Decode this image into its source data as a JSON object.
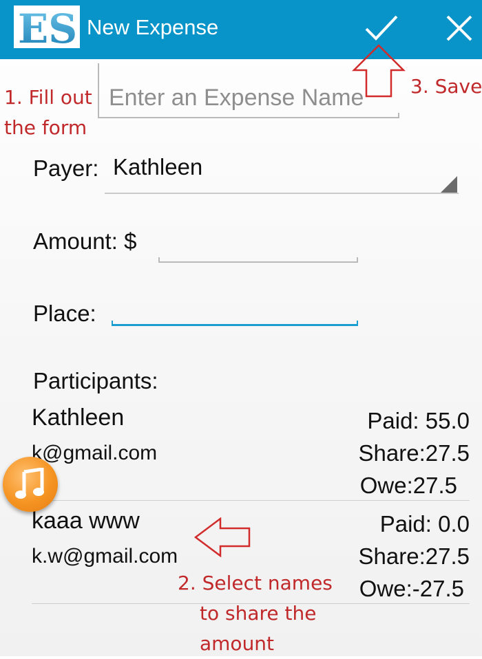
{
  "appbar": {
    "logo_text": "ES",
    "title": "New Expense",
    "save_icon": "check-icon",
    "close_icon": "close-icon",
    "color": "#0894c8"
  },
  "form": {
    "name_placeholder": "Enter an Expense Name",
    "name_value": "",
    "payer_label": "Payer:",
    "payer_value": "Kathleen",
    "amount_label": "Amount: $",
    "amount_value": "",
    "place_label": "Place:",
    "place_value": "",
    "participants_label": "Participants:"
  },
  "participants": [
    {
      "name": "Kathleen",
      "email": "k@gmail.com",
      "paid": "Paid: 55.0",
      "share": "Share:27.5",
      "owe": "Owe:27.5"
    },
    {
      "name": "kaaa www",
      "email": "k.w@gmail.com",
      "paid": "Paid: 0.0",
      "share": "Share:27.5",
      "owe": "Owe:-27.5"
    }
  ],
  "annotations": {
    "fill_line1": "1. Fill out",
    "fill_line2": "the form",
    "save": "3. Save",
    "select_line1": "2. Select names",
    "select_line2": "to share the",
    "select_line3": "amount",
    "color": "#c0282a"
  },
  "floating": {
    "icon": "music-note-icon",
    "color": "#f59422"
  }
}
